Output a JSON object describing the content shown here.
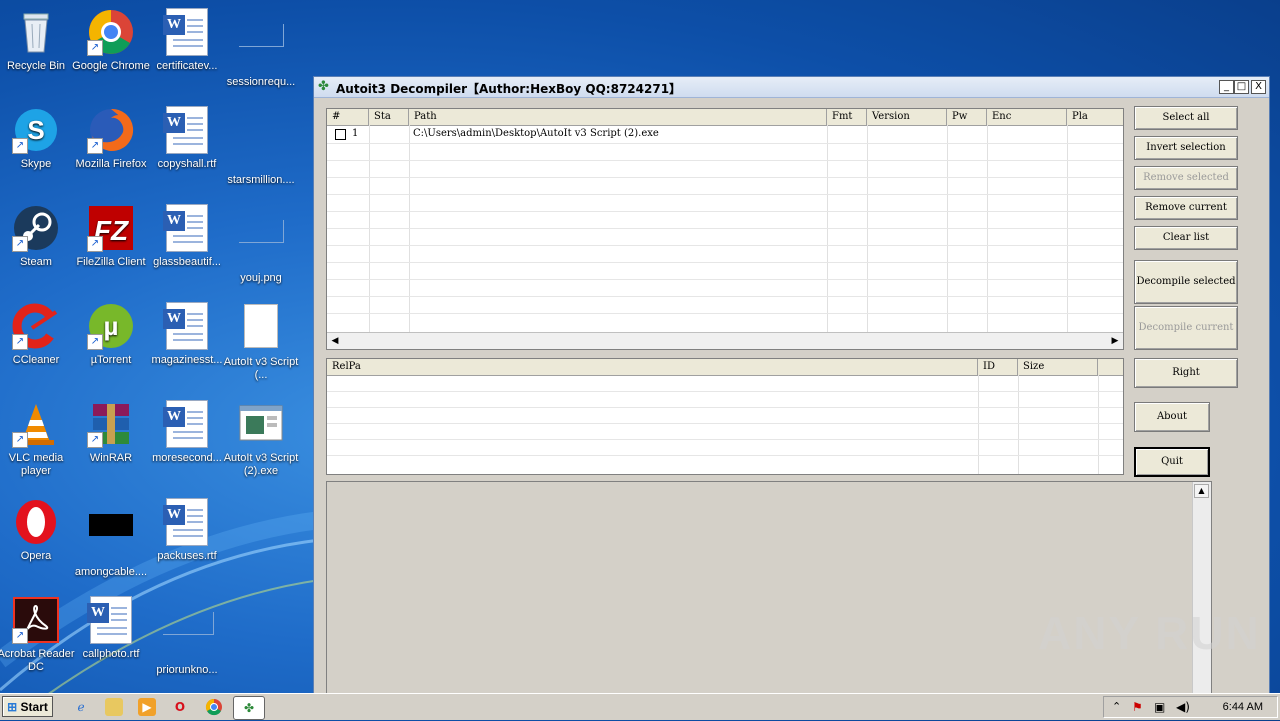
{
  "desktop": {
    "icons": [
      {
        "label": "Recycle Bin"
      },
      {
        "label": "Google Chrome"
      },
      {
        "label": "certificatev..."
      },
      {
        "label": "sessionrequ..."
      },
      {
        "label": "Skype"
      },
      {
        "label": "Mozilla Firefox"
      },
      {
        "label": "copyshall.rtf"
      },
      {
        "label": "starsmillion...."
      },
      {
        "label": "Steam"
      },
      {
        "label": "FileZilla Client"
      },
      {
        "label": "glassbeautif..."
      },
      {
        "label": "youj.png"
      },
      {
        "label": "CCleaner"
      },
      {
        "label": "µTorrent"
      },
      {
        "label": "magazinesst..."
      },
      {
        "label": "AutoIt v3 Script (..."
      },
      {
        "label": "VLC media player"
      },
      {
        "label": "WinRAR"
      },
      {
        "label": "moresecond..."
      },
      {
        "label": "AutoIt v3 Script (2).exe"
      },
      {
        "label": "Opera"
      },
      {
        "label": "amongcable...."
      },
      {
        "label": "packuses.rtf"
      },
      {
        "label": "Acrobat Reader DC"
      },
      {
        "label": "callphoto.rtf"
      },
      {
        "label": "priorunkno..."
      }
    ]
  },
  "window": {
    "title": "Autoit3 Decompiler【Author:HexBoy  QQ:8724271】",
    "min": "_",
    "max": "□",
    "close": "X",
    "file_list": {
      "columns": [
        "#",
        "Sta",
        "Path",
        "Fmt",
        "Version",
        "Pw",
        "Enc",
        "Pla"
      ],
      "rows": [
        {
          "num": "1",
          "sta": "",
          "path": "C:\\Users\\admin\\Desktop\\AutoIt v3 Script (2).exe",
          "fmt": "",
          "version": "",
          "pw": "",
          "enc": "",
          "pla": ""
        }
      ]
    },
    "resource_list": {
      "columns": [
        "RelPa",
        "ID",
        "Size"
      ]
    },
    "buttons": {
      "select_all": "Select all",
      "invert_selection": "Invert selection",
      "remove_selected": "Remove selected",
      "remove_current": "Remove current",
      "clear_list": "Clear list",
      "decompile_selected": "Decompile selected",
      "decompile_current": "Decompile current",
      "right": "Right",
      "about": "About",
      "quit": "Quit"
    }
  },
  "taskbar": {
    "start": "Start",
    "clock": "6:44 AM"
  },
  "watermark": "ANY RUN"
}
